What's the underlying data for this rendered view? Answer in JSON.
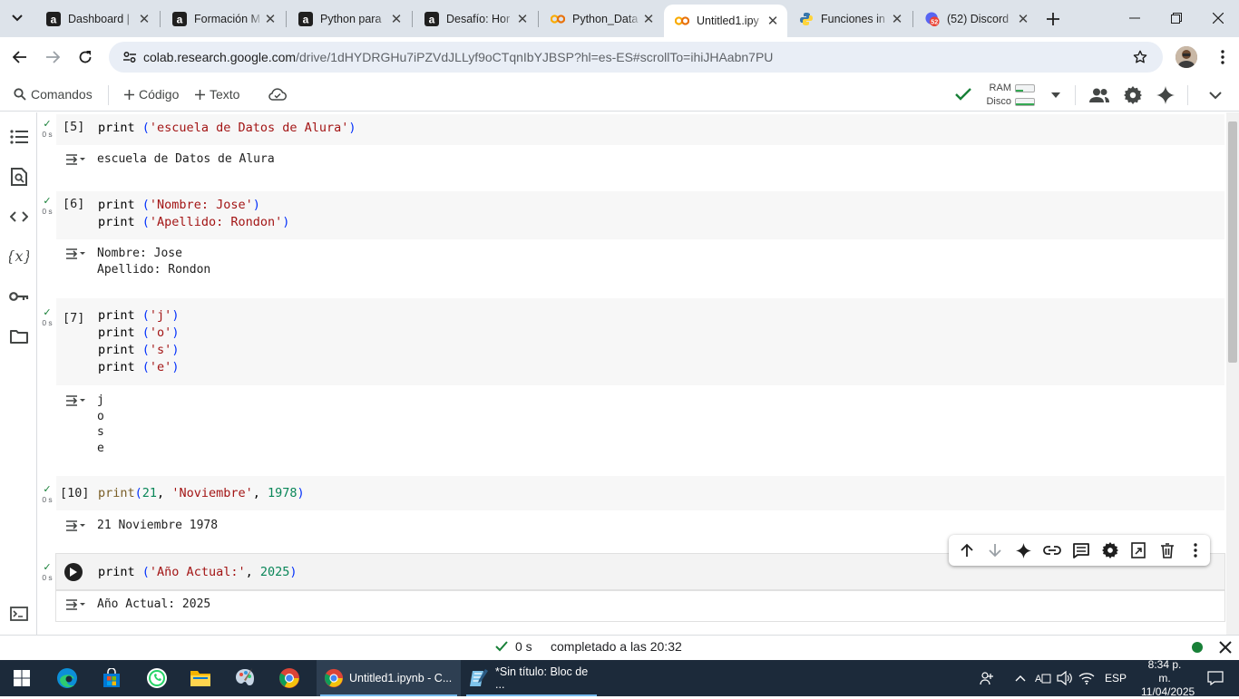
{
  "browser": {
    "tabs": [
      {
        "title": "Dashboard |",
        "icon": "alura-icon",
        "active": false
      },
      {
        "title": "Formación M",
        "icon": "alura-icon",
        "active": false
      },
      {
        "title": "Python para",
        "icon": "alura-icon",
        "active": false
      },
      {
        "title": "Desafío: Hor",
        "icon": "alura-icon",
        "active": false
      },
      {
        "title": "Python_Data",
        "icon": "colab-icon",
        "active": false
      },
      {
        "title": "Untitled1.ipy",
        "icon": "colab-icon",
        "active": true
      },
      {
        "title": "Funciones in",
        "icon": "python-icon",
        "active": false
      },
      {
        "title": "(52) Discord",
        "icon": "discord-icon",
        "active": false
      }
    ],
    "discord_badge": "52",
    "url_host": "colab.research.google.com",
    "url_path": "/drive/1dHYDRGHu7iPZVdJLLyf9oCTqnIbYJBSP?hl=es-ES#scrollTo=ihiJHAabn7PU"
  },
  "colab_toolbar": {
    "commands": "Comandos",
    "code": "Código",
    "text": "Texto",
    "ram": "RAM",
    "disk": "Disco"
  },
  "cells": [
    {
      "count": "[5]",
      "time": "0 s",
      "source": [
        "print ('escuela de Datos de Alura')"
      ],
      "output": [
        "escuela de Datos de Alura"
      ]
    },
    {
      "count": "[6]",
      "time": "0 s",
      "source": [
        "print ('Nombre: Jose')",
        "print ('Apellido: Rondon')"
      ],
      "output": [
        "Nombre: Jose",
        "Apellido: Rondon"
      ]
    },
    {
      "count": "[7]",
      "time": "0 s",
      "source": [
        "print ('j')",
        "print ('o')",
        "print ('s')",
        "print ('e')"
      ],
      "output": [
        "j",
        "o",
        "s",
        "e"
      ]
    },
    {
      "count": "[10]",
      "time": "0 s",
      "source": [
        "print(21, 'Noviembre', 1978)"
      ],
      "output": [
        "21 Noviembre 1978"
      ]
    },
    {
      "count": "",
      "time": "0 s",
      "source": [
        "print ('Año Actual:', 2025)"
      ],
      "output": [
        "Año Actual: 2025"
      ]
    }
  ],
  "status": {
    "elapsed": "0 s",
    "completed": "completado a las 20:32"
  },
  "taskbar": {
    "chrome_window": "Untitled1.ipynb - C...",
    "notepad_window": "*Sin título: Bloc de ...",
    "lang": "ESP",
    "time": "8:34 p. m.",
    "date": "11/04/2025"
  },
  "colors": {
    "accent_green": "#188038",
    "string_red": "#a31515",
    "number_green": "#098658",
    "taskbar_bg": "#1c2a3a"
  }
}
